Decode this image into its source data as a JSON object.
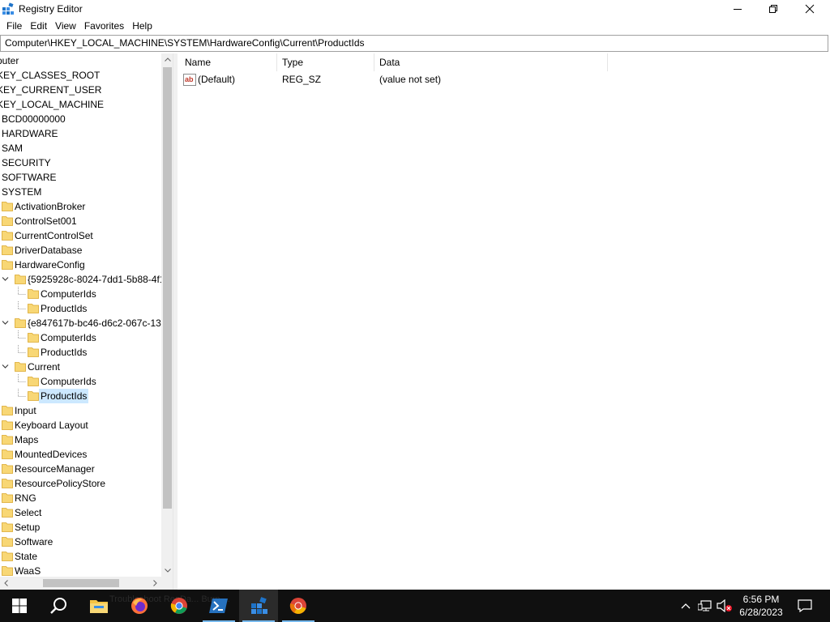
{
  "window": {
    "title": "Registry Editor",
    "icon": "regedit-icon",
    "controls": [
      "minimize-icon",
      "maximize-icon",
      "close-icon"
    ]
  },
  "menu": [
    "File",
    "Edit",
    "View",
    "Favorites",
    "Help"
  ],
  "address": "Computer\\HKEY_LOCAL_MACHINE\\SYSTEM\\HardwareConfig\\Current\\ProductIds",
  "tree": [
    {
      "label": "puter",
      "level": 0,
      "folder": false,
      "expander": "none"
    },
    {
      "label": "KEY_CLASSES_ROOT",
      "level": 0,
      "folder": false,
      "expander": "none"
    },
    {
      "label": "KEY_CURRENT_USER",
      "level": 0,
      "folder": false,
      "expander": "none"
    },
    {
      "label": "KEY_LOCAL_MACHINE",
      "level": 0,
      "folder": false,
      "expander": "none"
    },
    {
      "label": "BCD00000000",
      "level": 1,
      "folder": false,
      "expander": "none"
    },
    {
      "label": "HARDWARE",
      "level": 1,
      "folder": false,
      "expander": "none"
    },
    {
      "label": "SAM",
      "level": 1,
      "folder": false,
      "expander": "none"
    },
    {
      "label": "SECURITY",
      "level": 1,
      "folder": false,
      "expander": "none"
    },
    {
      "label": "SOFTWARE",
      "level": 1,
      "folder": false,
      "expander": "none"
    },
    {
      "label": "SYSTEM",
      "level": 1,
      "folder": false,
      "expander": "none"
    },
    {
      "label": "ActivationBroker",
      "level": 2,
      "folder": true,
      "expander": "none"
    },
    {
      "label": "ControlSet001",
      "level": 2,
      "folder": true,
      "expander": "none"
    },
    {
      "label": "CurrentControlSet",
      "level": 2,
      "folder": true,
      "expander": "none"
    },
    {
      "label": "DriverDatabase",
      "level": 2,
      "folder": true,
      "expander": "none"
    },
    {
      "label": "HardwareConfig",
      "level": 2,
      "folder": true,
      "expander": "none"
    },
    {
      "label": "{5925928c-8024-7dd1-5b88-4f1",
      "level": 3,
      "folder": true,
      "expander": "open"
    },
    {
      "label": "ComputerIds",
      "level": 4,
      "folder": true,
      "expander": "none"
    },
    {
      "label": "ProductIds",
      "level": 4,
      "folder": true,
      "expander": "none"
    },
    {
      "label": "{e847617b-bc46-d6c2-067c-13",
      "level": 3,
      "folder": true,
      "expander": "open"
    },
    {
      "label": "ComputerIds",
      "level": 4,
      "folder": true,
      "expander": "none"
    },
    {
      "label": "ProductIds",
      "level": 4,
      "folder": true,
      "expander": "none"
    },
    {
      "label": "Current",
      "level": 3,
      "folder": true,
      "expander": "open"
    },
    {
      "label": "ComputerIds",
      "level": 4,
      "folder": true,
      "expander": "none"
    },
    {
      "label": "ProductIds",
      "level": 4,
      "folder": true,
      "expander": "none",
      "selected": true
    },
    {
      "label": "Input",
      "level": 2,
      "folder": true,
      "expander": "none"
    },
    {
      "label": "Keyboard Layout",
      "level": 2,
      "folder": true,
      "expander": "none"
    },
    {
      "label": "Maps",
      "level": 2,
      "folder": true,
      "expander": "none"
    },
    {
      "label": "MountedDevices",
      "level": 2,
      "folder": true,
      "expander": "none"
    },
    {
      "label": "ResourceManager",
      "level": 2,
      "folder": true,
      "expander": "none"
    },
    {
      "label": "ResourcePolicyStore",
      "level": 2,
      "folder": true,
      "expander": "none"
    },
    {
      "label": "RNG",
      "level": 2,
      "folder": true,
      "expander": "none"
    },
    {
      "label": "Select",
      "level": 2,
      "folder": true,
      "expander": "none"
    },
    {
      "label": "Setup",
      "level": 2,
      "folder": true,
      "expander": "none"
    },
    {
      "label": "Software",
      "level": 2,
      "folder": true,
      "expander": "none"
    },
    {
      "label": "State",
      "level": 2,
      "folder": true,
      "expander": "none"
    },
    {
      "label": "WaaS",
      "level": 2,
      "folder": true,
      "expander": "none"
    }
  ],
  "columns": {
    "name": "Name",
    "type": "Type",
    "data": "Data"
  },
  "values": [
    {
      "name": "(Default)",
      "type": "REG_SZ",
      "data": "(value not set)",
      "icon": "string-value-icon"
    }
  ],
  "taskbar": {
    "apps": [
      "start-icon",
      "search-icon",
      "file-explorer-icon",
      "firefox-icon",
      "chrome-icon",
      "powershell-icon",
      "regedit-icon",
      "chrome-dev-icon"
    ],
    "ghost_text": "Troubleshoot RegDa... Burp ... ",
    "tray_icons": [
      "chevron-up-icon",
      "network-icon",
      "volume-muted-icon"
    ],
    "time": "6:56 PM",
    "date": "6/28/2023",
    "notification_icon": "notification-icon"
  },
  "colors": {
    "selection": "#cce8ff",
    "taskbar": "#101010",
    "folder": "#f8d775",
    "active_indicator": "#76b9ed"
  }
}
